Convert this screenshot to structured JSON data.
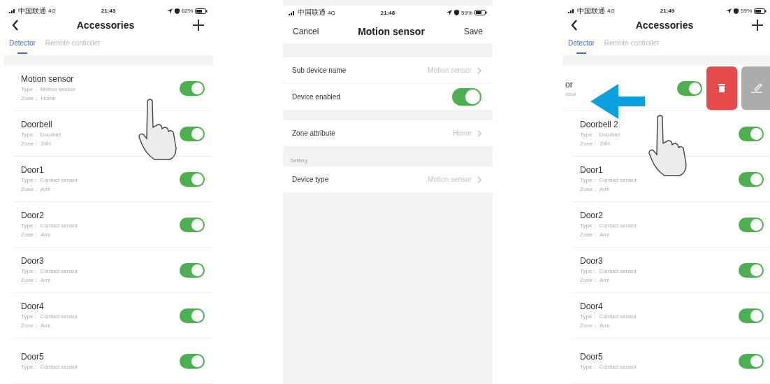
{
  "screens": [
    {
      "kind": "list",
      "status_bar": {
        "carrier": "中国联通",
        "network": "4G",
        "time": "21:43",
        "battery": "62%"
      },
      "nav": {
        "title": "Accessories"
      },
      "tabs": [
        {
          "label": "Detector",
          "selected": true
        },
        {
          "label": "Remote controller",
          "selected": false
        }
      ],
      "rows": [
        {
          "name": "Motion sensor",
          "type": "Type： Motion sensor",
          "zone": "Zone： Home",
          "on": true,
          "swiped": false
        },
        {
          "name": "Doorbell",
          "type": "Type： Doorbell",
          "zone": "Zone： 24H",
          "on": true,
          "swiped": false
        },
        {
          "name": "Door1",
          "type": "Type： Contact sensor",
          "zone": "Zone： Arm",
          "on": true,
          "swiped": false
        },
        {
          "name": "Door2",
          "type": "Type： Contact sensor",
          "zone": "Zone： Arm",
          "on": true,
          "swiped": false
        },
        {
          "name": "Door3",
          "type": "Type： Contact sensor",
          "zone": "Zone： Arm",
          "on": true,
          "swiped": false
        },
        {
          "name": "Door4",
          "type": "Type： Contact sensor",
          "zone": "Zone： Arm",
          "on": true,
          "swiped": false
        },
        {
          "name": "Door5",
          "type": "Type： Contact sensor",
          "on": true,
          "swiped": false
        }
      ]
    },
    {
      "kind": "form",
      "status_bar": {
        "carrier": "中国联通",
        "network": "4G",
        "time": "21:48",
        "battery": "59%"
      },
      "nav": {
        "left": "Cancel",
        "title": "Motion sensor",
        "right": "Save"
      },
      "sections": [
        {
          "rows": [
            {
              "kind": "link",
              "label": "Sub device name",
              "value": "Motion sensor"
            },
            {
              "kind": "toggle",
              "label": "Device enabled",
              "on": true
            }
          ]
        },
        {
          "rows": [
            {
              "kind": "link",
              "label": "Zone attribute",
              "value": "Home"
            }
          ]
        },
        {
          "header": "Setting",
          "rows": [
            {
              "kind": "link",
              "label": "Device type",
              "value": "Motion sensor"
            }
          ]
        }
      ]
    },
    {
      "kind": "list",
      "status_bar": {
        "carrier": "中国联通",
        "network": "4G",
        "time": "21:49",
        "battery": "59%"
      },
      "nav": {
        "title": "Accessories"
      },
      "tabs": [
        {
          "label": "Detector",
          "selected": true
        },
        {
          "label": "Remote controller",
          "selected": false
        }
      ],
      "rows": [
        {
          "name": "or",
          "type": "nsor",
          "on": true,
          "swiped": true
        },
        {
          "name": "Doorbell 2",
          "type": "Type： Doorbell",
          "zone": "Zone： 24H",
          "on": true,
          "swiped": false
        },
        {
          "name": "Door1",
          "type": "Type： Contact sensor",
          "zone": "Zone： Arm",
          "on": true,
          "swiped": false
        },
        {
          "name": "Door2",
          "type": "Type： Contact sensor",
          "zone": "Zone： Arm",
          "on": true,
          "swiped": false
        },
        {
          "name": "Door3",
          "type": "Type： Contact sensor",
          "zone": "Zone： Arm",
          "on": true,
          "swiped": false
        },
        {
          "name": "Door4",
          "type": "Type： Contact sensor",
          "zone": "Zone： Arm",
          "on": true,
          "swiped": false
        },
        {
          "name": "Door5",
          "type": "Type： Contact sensor",
          "on": true,
          "swiped": false
        }
      ]
    }
  ]
}
